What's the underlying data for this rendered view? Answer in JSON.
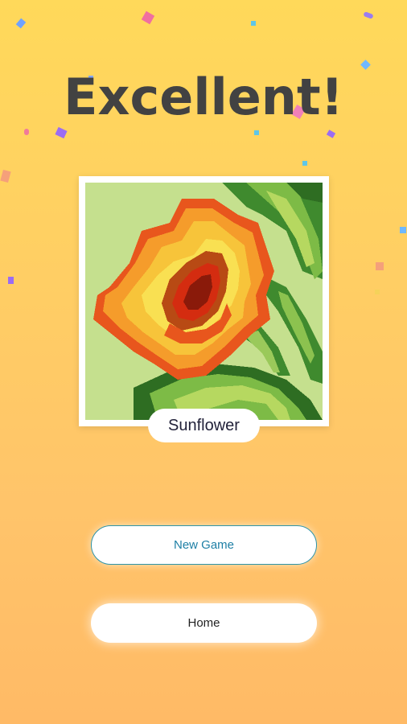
{
  "title": "Excellent!",
  "artwork": {
    "name": "Sunflower",
    "icon": "sunflower-pixel-art"
  },
  "buttons": {
    "new_game": "New Game",
    "home": "Home"
  },
  "colors": {
    "accent": "#2c93a8",
    "title": "#424242",
    "background_top": "#ffd95a",
    "background_bottom": "#ffba66"
  }
}
